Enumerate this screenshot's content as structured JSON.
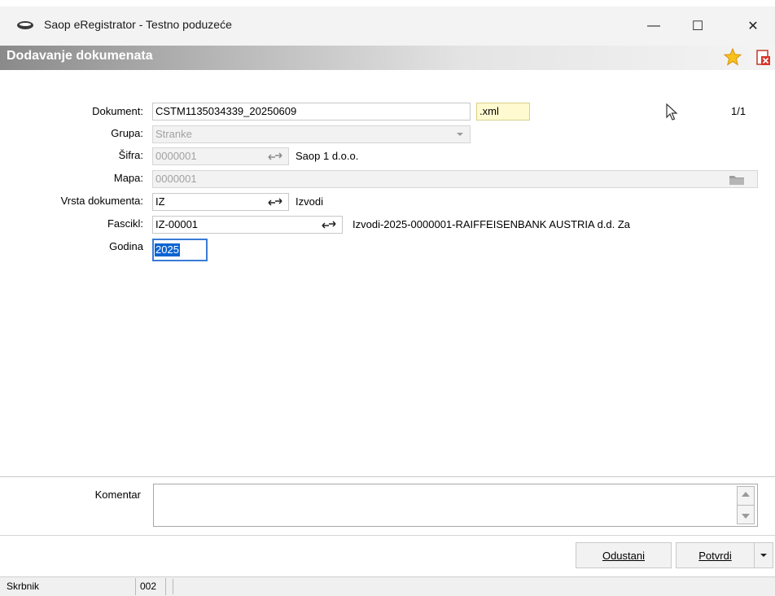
{
  "window": {
    "icon": "eye-shaped-app-icon",
    "title": "Saop eRegistrator - Testno poduzeće",
    "minimize": "—",
    "maximize": "☐",
    "close": "✕"
  },
  "dialog": {
    "title": "Dodavanje dokumenata",
    "favorite_icon": "star-icon",
    "close_icon": "close-document-icon"
  },
  "page_counter": "1/1",
  "form": {
    "dokument": {
      "label": "Dokument:",
      "value": "CSTM1135034339_20250609",
      "extension": ".xml"
    },
    "grupa": {
      "label": "Grupa:",
      "value": "Stranke"
    },
    "sifra": {
      "label": "Šifra:",
      "value": "0000001",
      "name": "Saop 1 d.o.o."
    },
    "mapa": {
      "label": "Mapa:",
      "value": "0000001",
      "folder_icon": "folder-icon"
    },
    "vrsta_dokumenta": {
      "label": "Vrsta dokumenta:",
      "value": "IZ",
      "name": "Izvodi"
    },
    "fascikl": {
      "label": "Fascikl:",
      "value": "IZ-00001",
      "name": "Izvodi-2025-0000001-RAIFFEISENBANK AUSTRIA d.d. Za"
    },
    "godina": {
      "label": "Godina",
      "value": "2025"
    }
  },
  "komentar": {
    "label": "Komentar",
    "value": ""
  },
  "buttons": {
    "cancel": "Odustani",
    "confirm": "Potvrdi"
  },
  "statusbar": {
    "user": "Skrbnik",
    "code": "002"
  },
  "colors": {
    "selection": "#0a64d2",
    "extension_bg": "#fffad0",
    "header_gradient_start": "#8a8a8a"
  }
}
